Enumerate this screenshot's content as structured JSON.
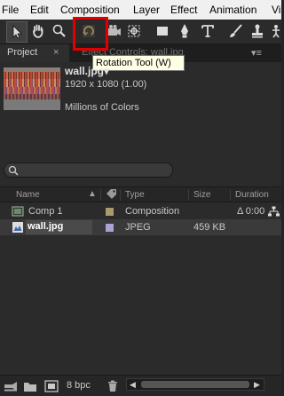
{
  "menu": [
    "File",
    "Edit",
    "Composition",
    "Layer",
    "Effect",
    "Animation",
    "Vi"
  ],
  "toolbar": {
    "tools": [
      "selection-tool",
      "hand-tool",
      "zoom-tool",
      "rotation-tool",
      "camera-tool",
      "pan-behind-tool",
      "rectangle-tool",
      "pen-tool",
      "type-tool",
      "brush-tool",
      "puppet-tool"
    ],
    "active_tool": "selection-tool",
    "highlighted_tool": "rotation-tool"
  },
  "tooltip": "Rotation Tool (W)",
  "panel": {
    "tab_label": "Project",
    "tab_close": "×",
    "tab_effect_controls": "Effect Controls: wall.jpg",
    "menu_glyph": "▾≡"
  },
  "selected_item": {
    "name": "wall.jpg▾",
    "dimensions": "1920 x 1080 (1.00)",
    "color_depth": "Millions of Colors"
  },
  "columns": {
    "name": "Name",
    "type": "Type",
    "size": "Size",
    "duration": "Duration"
  },
  "items": [
    {
      "name": "Comp 1",
      "type": "Composition",
      "size": "",
      "duration": "Δ 0:00",
      "label_color": "#a89c6c",
      "icon": "composition-icon"
    },
    {
      "name": "wall.jpg",
      "type": "JPEG",
      "size": "459 KB",
      "duration": "",
      "label_color": "#a9a3d6",
      "icon": "image-file-icon"
    }
  ],
  "footer": {
    "bit_depth": "8 bpc"
  },
  "colors": {
    "panel_bg": "#2b2b2b",
    "highlight_box": "#e00000",
    "tooltip_bg": "#ffffe6"
  }
}
